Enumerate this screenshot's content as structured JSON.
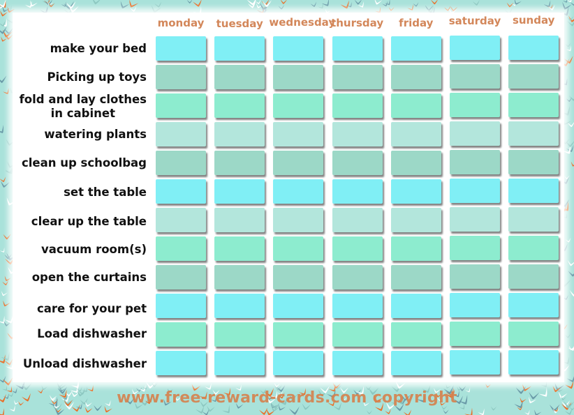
{
  "chart": {
    "days": [
      "monday",
      "tuesday",
      "wednesday",
      "thursday",
      "friday",
      "saturday",
      "sunday"
    ],
    "tasks": [
      {
        "label": "make your bed",
        "color": "#80eff5"
      },
      {
        "label": "Picking up toys",
        "color": "#9cd8c7"
      },
      {
        "label": "fold and lay clothes\nin cabinet",
        "color": "#8deccf"
      },
      {
        "label": "watering plants",
        "color": "#b3e6dc"
      },
      {
        "label": "clean up schoolbag",
        "color": "#9cd8c7"
      },
      {
        "label": "set the table",
        "color": "#80eff5"
      },
      {
        "label": "clear up the table",
        "color": "#b3e6dc"
      },
      {
        "label": "vacuum room(s)",
        "color": "#8deccf"
      },
      {
        "label": "open the curtains",
        "color": "#9cd8c7"
      },
      {
        "label": "care for your pet",
        "color": "#80eff5"
      },
      {
        "label": "Load dishwasher",
        "color": "#8deccf"
      },
      {
        "label": "Unload dishwasher",
        "color": "#80eff5"
      }
    ]
  },
  "colors": {
    "background": "#a9e2da",
    "header_text": "#d3875a",
    "bird_orange": "#e8702a",
    "bird_slate": "#6a9aa8",
    "bird_white": "#ffffff"
  },
  "footer": {
    "watermark": "www.free-reward-cards.com copyright"
  }
}
